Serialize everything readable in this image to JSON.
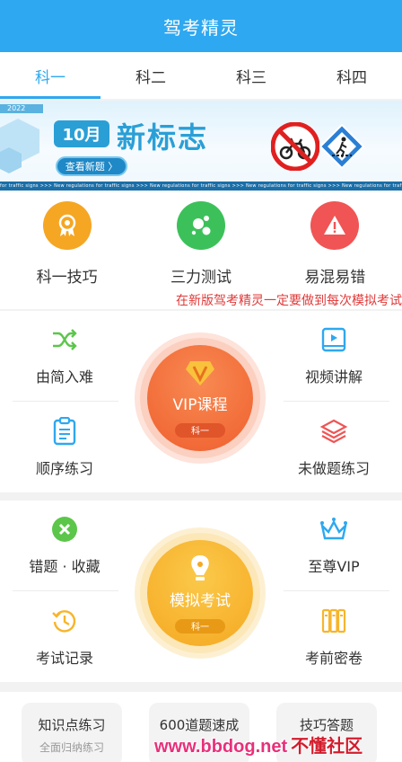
{
  "app": {
    "title": "驾考精灵"
  },
  "tabs": [
    {
      "label": "科一",
      "active": true
    },
    {
      "label": "科二",
      "active": false
    },
    {
      "label": "科三",
      "active": false
    },
    {
      "label": "科四",
      "active": false
    }
  ],
  "banner": {
    "year_tag": "2022",
    "month": "10月",
    "title": "新标志",
    "button": "查看新题 〉",
    "strip_text": "for traffic signs  >>>  New regulations for traffic signs  >>>  New regulations for traffic signs  >>>  New regulations for traffic signs  >>>  New regulations for traffic signs"
  },
  "shortcuts": [
    {
      "label": "科一技巧",
      "icon": "medal-icon",
      "color": "#f5a623"
    },
    {
      "label": "三力测试",
      "icon": "bubbles-icon",
      "color": "#3cc15a"
    },
    {
      "label": "易混易错",
      "icon": "warning-icon",
      "color": "#f05454"
    }
  ],
  "marquee": {
    "text": "在新版驾考精灵一定要做到每次模拟考试都能过"
  },
  "panel1": {
    "top_left": {
      "label": "由简入难",
      "icon": "shuffle-icon"
    },
    "top_right": {
      "label": "视频讲解",
      "icon": "video-icon"
    },
    "bottom_left": {
      "label": "顺序练习",
      "icon": "clipboard-icon"
    },
    "bottom_right": {
      "label": "未做题练习",
      "icon": "layers-icon"
    },
    "center": {
      "label": "VIP课程",
      "sub": "科一",
      "icon": "vip-gem-icon"
    }
  },
  "panel2": {
    "top_left": {
      "label": "错题 · 收藏",
      "icon": "close-circle-icon"
    },
    "top_right": {
      "label": "至尊VIP",
      "icon": "crown-icon"
    },
    "bottom_left": {
      "label": "考试记录",
      "icon": "history-icon"
    },
    "bottom_right": {
      "label": "考前密卷",
      "icon": "papers-icon"
    },
    "center": {
      "label": "模拟考试",
      "sub": "科一",
      "icon": "pen-nib-icon"
    }
  },
  "cards": [
    {
      "title": "知识点练习",
      "sub": "全面归纳练习"
    },
    {
      "title": "600道题速成",
      "sub": ""
    },
    {
      "title": "技巧答题",
      "sub": ""
    }
  ],
  "watermark": {
    "site": "www.bbdog.net",
    "name": "不懂社区"
  },
  "colors": {
    "primary": "#2ea8f0",
    "vip_orange": "#f26b3a",
    "exam_yellow": "#f7b52c",
    "alert_red": "#e03a3a",
    "green": "#5cc64a"
  }
}
